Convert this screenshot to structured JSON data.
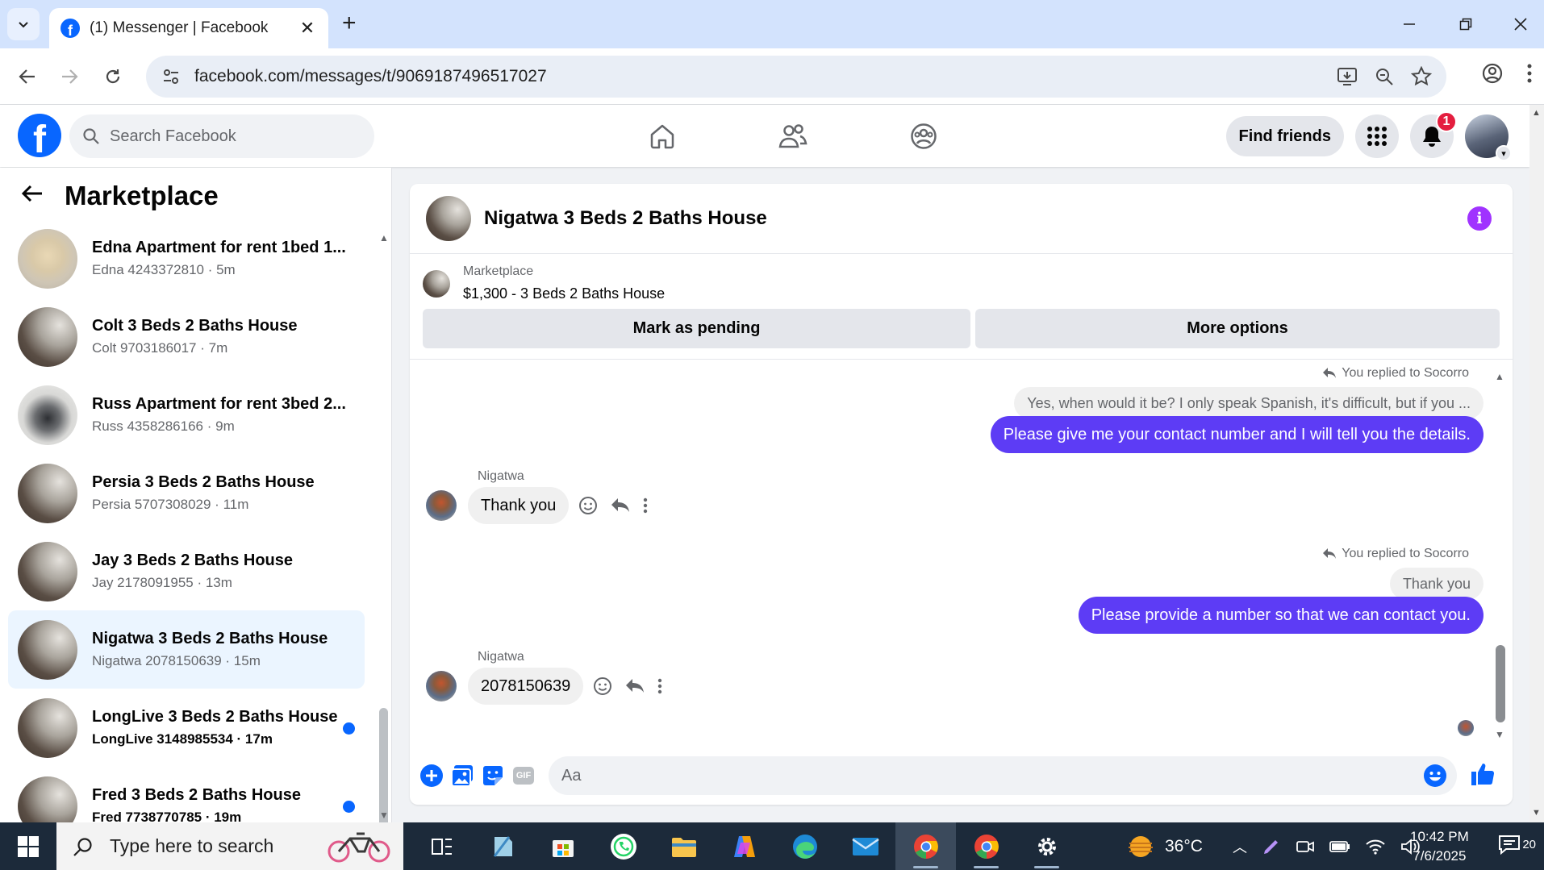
{
  "browser": {
    "tab_title": "(1) Messenger | Facebook",
    "url": "facebook.com/messages/t/9069187496517027"
  },
  "facebook": {
    "search_placeholder": "Search Facebook",
    "find_friends": "Find friends",
    "notification_count": "1"
  },
  "left_panel": {
    "title": "Marketplace",
    "conversations": [
      {
        "name": "Edna Apartment for rent 1bed 1...",
        "sub": "Edna 4243372810 · 5m",
        "thumb": "apt1",
        "unread": false,
        "active": false
      },
      {
        "name": "Colt 3 Beds 2 Baths House",
        "sub": "Colt 9703186017 · 7m",
        "thumb": "house",
        "unread": false,
        "active": false
      },
      {
        "name": "Russ Apartment for rent 3bed 2...",
        "sub": "Russ 4358286166 · 9m",
        "thumb": "apt2",
        "unread": false,
        "active": false
      },
      {
        "name": "Persia 3 Beds 2 Baths House",
        "sub": "Persia 5707308029 · 11m",
        "thumb": "house",
        "unread": false,
        "active": false
      },
      {
        "name": "Jay 3 Beds 2 Baths House",
        "sub": "Jay 2178091955 · 13m",
        "thumb": "house",
        "unread": false,
        "active": false
      },
      {
        "name": "Nigatwa 3 Beds 2 Baths House",
        "sub": "Nigatwa 2078150639 · 15m",
        "thumb": "house",
        "unread": false,
        "active": true
      },
      {
        "name": "LongLive 3 Beds 2 Baths House",
        "sub": "LongLive 3148985534 · 17m",
        "thumb": "house",
        "unread": true,
        "active": false
      },
      {
        "name": "Fred 3 Beds 2 Baths House",
        "sub": "Fred 7738770785 · 19m",
        "thumb": "house",
        "unread": true,
        "active": false
      }
    ]
  },
  "chat": {
    "title": "Nigatwa 3 Beds 2 Baths House",
    "listing_label": "Marketplace",
    "listing_detail": "$1,300 - 3 Beds 2 Baths House",
    "mark_pending": "Mark as pending",
    "more_options": "More options",
    "reply1_label": "You replied to Socorro",
    "reply1_quoted": "Yes, when would it be? I only speak Spanish, it's difficult, but if you ...",
    "reply1_text": "Please give me your contact number and I will tell you the details.",
    "incoming1_sender": "Nigatwa",
    "incoming1_text": "Thank you",
    "reply2_label": "You replied to Socorro",
    "reply2_quoted": "Thank you",
    "reply2_text": "Please provide a number so that we can contact you.",
    "incoming2_sender": "Nigatwa",
    "incoming2_text": "2078150639",
    "composer_placeholder": "Aa",
    "gif_label": "GIF"
  },
  "taskbar": {
    "search_placeholder": "Type here to search",
    "temperature": "36°C",
    "time": "10:42 PM",
    "date": "7/6/2025",
    "notification_count": "20"
  },
  "colors": {
    "facebook_blue": "#0866ff",
    "outgoing_bubble": "#5d3cf5",
    "info_purple": "#a033ff",
    "badge_red": "#e41e3f"
  }
}
